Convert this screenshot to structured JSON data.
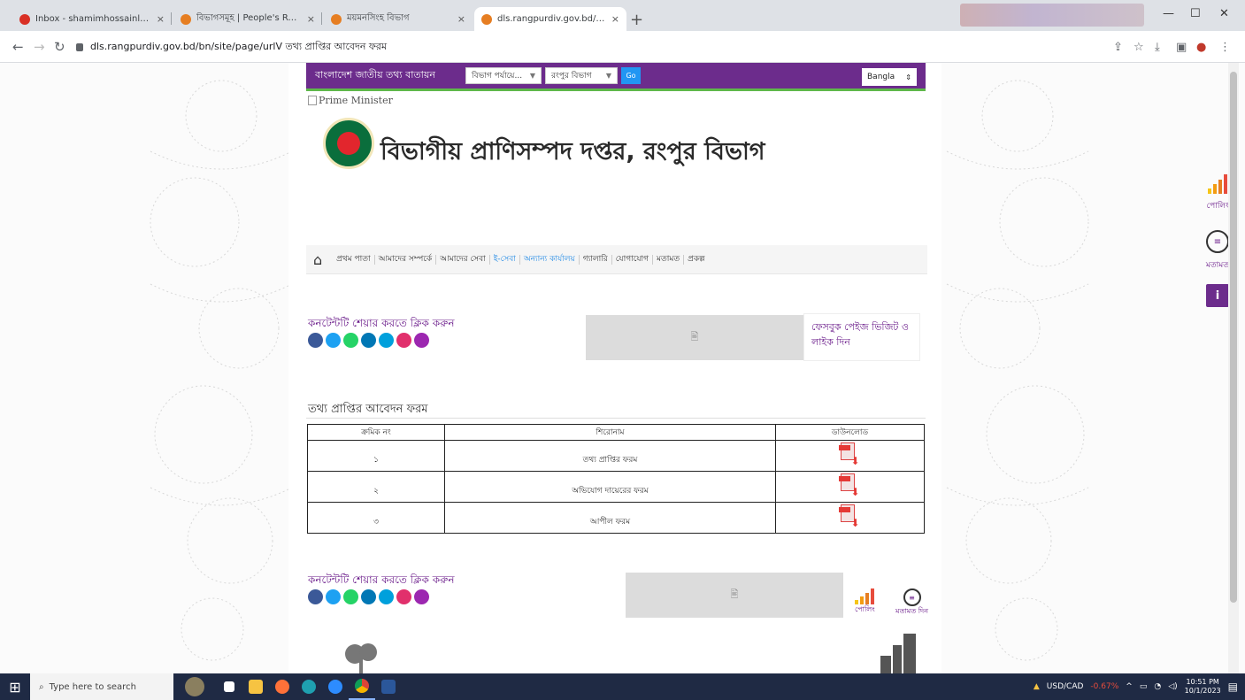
{
  "browser": {
    "tabs": [
      {
        "label": "Inbox - shamimhossainlms@gm",
        "icon": "gmail-icon",
        "color": "#d93025"
      },
      {
        "label": "বিভাগসমূহ | People's Republic o",
        "icon": "gov-icon",
        "color": "#e67e22"
      },
      {
        "label": "ময়মনসিংহ বিভাগ",
        "icon": "gov-icon",
        "color": "#e67e22"
      },
      {
        "label": "dls.rangpurdiv.gov.bd/bn/site/p",
        "icon": "gov-icon",
        "color": "#e67e22"
      }
    ],
    "url": "dls.rangpurdiv.gov.bd/bn/site/page/urlV তথ্য প্রাপ্তির আবেদন ফরম"
  },
  "topbar": {
    "portal_label": "বাংলাদেশ জাতীয় তথ্য বাতায়ন",
    "division_select": "বিভাগ পর্যায়ে...",
    "office_select": "রংপুর বিভাগ",
    "go_label": "Go",
    "language": "Bangla"
  },
  "header": {
    "pm_alt": "Prime Minister",
    "site_title": "বিভাগীয় প্রাণিসম্পদ দপ্তর, রংপুর বিভাগ"
  },
  "menu": {
    "items": [
      "প্রথম পাতা",
      "আমাদের সম্পর্কে",
      "আমাদের সেবা",
      "ই-সেবা",
      "অন্যান্য কার্যালয়",
      "গ্যালারি",
      "যোগাযোগ",
      "মতামত",
      "প্রকল্প"
    ]
  },
  "share": {
    "title": "কনটেন্টটি শেয়ার করতে ক্লিক করুন",
    "facebook_text": "ফেসবুক পেইজ ভিজিট ও লাইক দিন"
  },
  "form": {
    "title": "তথ্য প্রাপ্তির আবেদন ফরম",
    "columns": [
      "ক্রমিক নং",
      "শিরোনাম",
      "ডাউনলোড"
    ],
    "rows": [
      {
        "serial": "১",
        "title": "তথ্য প্রাপ্তির ফরম"
      },
      {
        "serial": "২",
        "title": "অভিযোগ দায়েরের ফরম"
      },
      {
        "serial": "৩",
        "title": "আপীল ফরম"
      }
    ]
  },
  "footer_share": {
    "title": "কনটেন্টটি শেয়ার করতে ক্লিক করুন",
    "poll_label": "পোলিং",
    "feedback_label": "মতামত দিন"
  },
  "floating": {
    "poll_label": "পোলিং",
    "feedback_label": "মতামত"
  },
  "taskbar": {
    "search_placeholder": "Type here to search",
    "ticker": "USD/CAD",
    "ticker_change": "-0.67%",
    "time": "10:51 PM",
    "date": "10/1/2023"
  },
  "colors": {
    "brand_purple": "#6c2c8c",
    "accent_green": "#5fb84a",
    "social": [
      "#3b5998",
      "#1da1f2",
      "#25d366",
      "#0077b5",
      "#00a0dc",
      "#e1306c",
      "#9c27b0"
    ]
  }
}
